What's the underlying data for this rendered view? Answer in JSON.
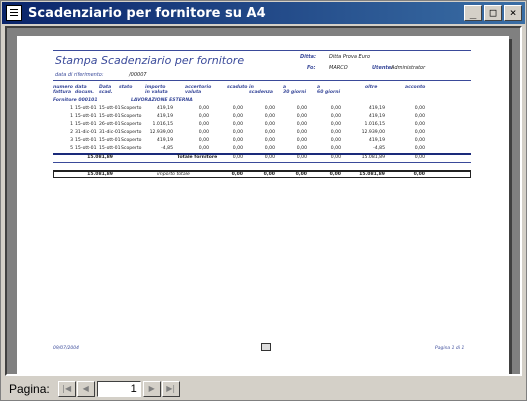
{
  "window": {
    "title": "Scadenziario per fornitore su A4"
  },
  "report": {
    "heading": "Stampa Scadenziario per fornitore",
    "ref_date_label": "data di riferimento:",
    "ref_date_value": "/00007",
    "ditta_label": "Ditta:",
    "ditta_value": "Ditta Prova Euro",
    "fo_label": "Fo:",
    "fo_value": "MARCO",
    "utente_label": "Utente:",
    "utente_value": "Administrator",
    "columns": [
      "numero fattura",
      "data docum.",
      "Data scad.",
      "stato",
      "importo in valuta",
      "accertorio valuta",
      "scaduto",
      "in scadenza",
      "a 30 giorni",
      "a 60 giorni",
      "oltre",
      "acconto"
    ],
    "group_label": "Fornitore  000101",
    "group_name": "LAVORAZIONE ESTERNA",
    "rows": [
      [
        "1",
        "15-ott-01",
        "15-ott-01",
        "Scoperto",
        "419,19",
        "0,00",
        "0,00",
        "0,00",
        "0,00",
        "0,00",
        "419,19",
        "0,00"
      ],
      [
        "1",
        "15-ott-01",
        "15-ott-01",
        "Scoperto",
        "419,19",
        "0,00",
        "0,00",
        "0,00",
        "0,00",
        "0,00",
        "419,19",
        "0,00"
      ],
      [
        "1",
        "15-ott-01",
        "26-ott-01",
        "Scoperto",
        "1.016,15",
        "0,00",
        "0,00",
        "0,00",
        "0,00",
        "0,00",
        "1.016,15",
        "0,00"
      ],
      [
        "2",
        "31-dic-01",
        "31-dic-01",
        "Scoperto",
        "12.939,00",
        "0,00",
        "0,00",
        "0,00",
        "0,00",
        "0,00",
        "12.939,00",
        "0,00"
      ],
      [
        "3",
        "15-ott-01",
        "15-ott-01",
        "Scoperto",
        "419,19",
        "0,00",
        "0,00",
        "0,00",
        "0,00",
        "0,00",
        "419,19",
        "0,00"
      ],
      [
        "5",
        "15-ott-01",
        "15-ott-01",
        "Scoperto",
        "-4,85",
        "0,00",
        "0,00",
        "0,00",
        "0,00",
        "0,00",
        "-4,85",
        "0,00"
      ]
    ],
    "subtotal_amount": "15.081,89",
    "subtotal_label": "Totale fornitore",
    "subtotal_values": [
      "0,00",
      "0,00",
      "0,00",
      "0,00",
      "15.081,89",
      "0,00"
    ],
    "grand_amount": "15.081,89",
    "grand_label": "importo totale",
    "grand_values": [
      "0,00",
      "0,00",
      "0,00",
      "0,00",
      "15.081,89",
      "0,00"
    ],
    "footer_left": "09/07/2004",
    "footer_right": "Pagina 1 di 1"
  },
  "nav": {
    "label": "Pagina:",
    "page": "1"
  }
}
